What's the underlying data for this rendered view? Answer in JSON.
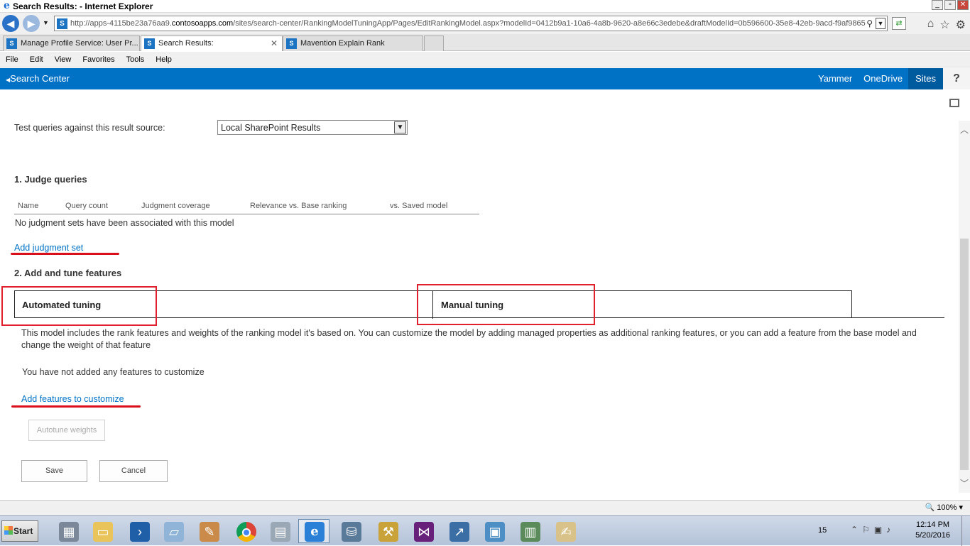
{
  "window": {
    "title": "Search Results: - Internet Explorer",
    "buttons": [
      "_",
      "▫",
      "✕"
    ]
  },
  "address": {
    "url_prefix": "http://apps-4115be23a76aa9.",
    "url_domain": "contosoapps.com",
    "url_rest": "/sites/search-center/RankingModelTuningApp/Pages/EditRankingModel.aspx?modelId=0412b9a1-10a6-4a8b-9620-a8e66c3edebe&draftModelId=0b596600-35e8-42eb-9acd-f9af9865a"
  },
  "tabs": [
    {
      "label": "Manage Profile Service: User Pr..."
    },
    {
      "label": "Search Results:",
      "close": "✕"
    },
    {
      "label": "Mavention Explain Rank"
    }
  ],
  "menu": [
    "File",
    "Edit",
    "View",
    "Favorites",
    "Tools",
    "Help"
  ],
  "suitebar": {
    "back_label": "Search Center",
    "links": [
      "Yammer",
      "OneDrive",
      "Sites"
    ],
    "help": "?"
  },
  "page": {
    "test_queries_label": "Test queries against this result source:",
    "result_source": "Local SharePoint Results",
    "judge_heading": "1. Judge queries",
    "columns": [
      "Name",
      "Query count",
      "Judgment coverage",
      "Relevance vs. Base ranking",
      "vs. Saved model"
    ],
    "no_judgments": "No judgment sets have been associated with this model",
    "add_judgment_link": "Add judgment set",
    "tune_heading": "2. Add and tune features",
    "tab_automated": "Automated tuning",
    "tab_manual": "Manual tuning",
    "description": "This model includes the rank features and weights of the ranking model it's based on. You can customize the model by adding managed properties as additional ranking features, or you can add a feature from the base model and change the weight of that feature",
    "no_features": "You have not added any features to customize",
    "add_features_link": "Add features to customize",
    "autotune_button": "Autotune weights",
    "save_button": "Save",
    "cancel_button": "Cancel"
  },
  "status": {
    "zoom": "100%"
  },
  "taskbar": {
    "start": "Start",
    "tray_number": "15",
    "time": "12:14 PM",
    "date": "5/20/2016"
  },
  "colors": {
    "suitebar": "#0072c6",
    "link": "#0072c6",
    "highlight": "#e0202c"
  }
}
